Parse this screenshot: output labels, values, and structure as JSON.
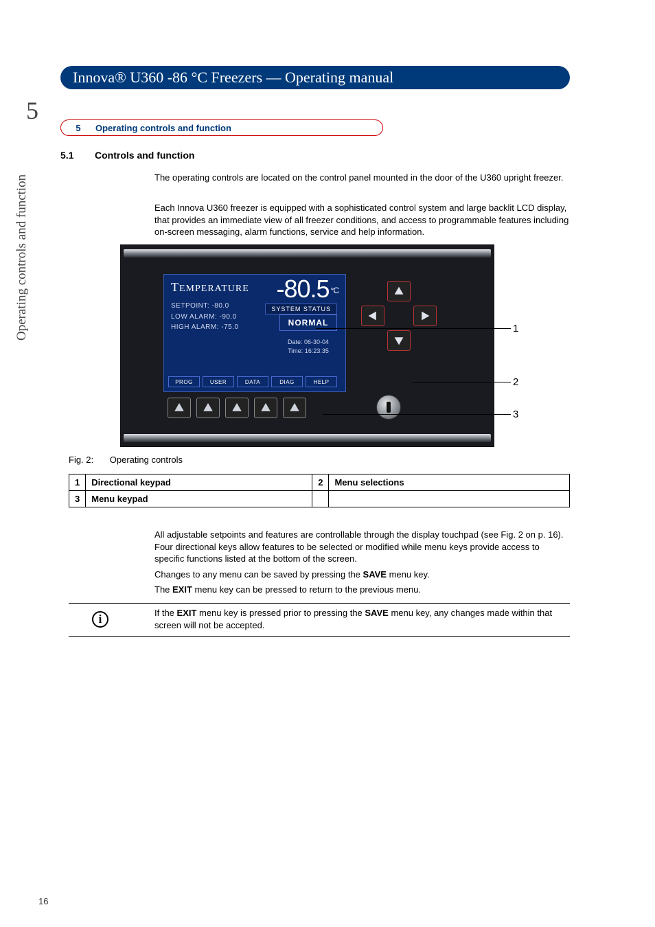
{
  "page": {
    "chapter_number": "5",
    "side_caption": "Operating controls and function",
    "page_number": "16",
    "title": "Innova® U360 -86 °C Freezers  —  Operating manual"
  },
  "section": {
    "num": "5",
    "label": "Operating controls and function"
  },
  "subsection": {
    "num": "5.1",
    "label": "Controls and function"
  },
  "para1": "The operating controls are located on the control panel mounted in the door of the U360 upright freezer.",
  "para2": "Each Innova U360 freezer is equipped with a sophisticated control system and large backlit LCD display, that provides an immediate view of all freezer conditions, and access to programmable features including on-screen messaging, alarm functions, service and help information.",
  "panel": {
    "temp_label_cap": "T",
    "temp_label_rest": "EMPERATURE",
    "temp_value": "-80.5",
    "temp_unit": "°C",
    "setpoint": "SETPOINT: -80.0",
    "low_alarm": "LOW ALARM:  -90.0",
    "high_alarm": "HIGH ALARM:  -75.0",
    "status_label": "SYSTEM STATUS",
    "status_value": "NORMAL",
    "date": "Date: 06-30-04",
    "time": "Time: 16:23:35",
    "menus": [
      "PROG",
      "USER",
      "DATA",
      "DIAG",
      "HELP"
    ]
  },
  "callouts": {
    "c1": "1",
    "c2": "2",
    "c3": "3"
  },
  "figure": {
    "num": "Fig. 2:",
    "caption": "Operating controls"
  },
  "legend": {
    "r1k": "1",
    "r1v": "Directional keypad",
    "r2k": "2",
    "r2v": "Menu selections",
    "r3k": "3",
    "r3v": "Menu keypad"
  },
  "para3": "All adjustable setpoints and features are controllable through the display touchpad (see Fig. 2 on p. 16). Four directional keys allow features to be selected or modified while menu keys provide access to specific functions listed at the bottom of the screen.",
  "para4_a": "Changes to any menu can be saved by pressing the ",
  "para4_b": "SAVE",
  "para4_c": " menu key.",
  "para5_a": "The ",
  "para5_b": "EXIT",
  "para5_c": " menu key can be pressed to return to the previous menu.",
  "note_a": " If the ",
  "note_b": "EXIT",
  "note_c": " menu key is pressed prior to pressing the ",
  "note_d": "SAVE",
  "note_e": " menu key, any changes made within that screen will not be accepted.",
  "info_glyph": "i"
}
